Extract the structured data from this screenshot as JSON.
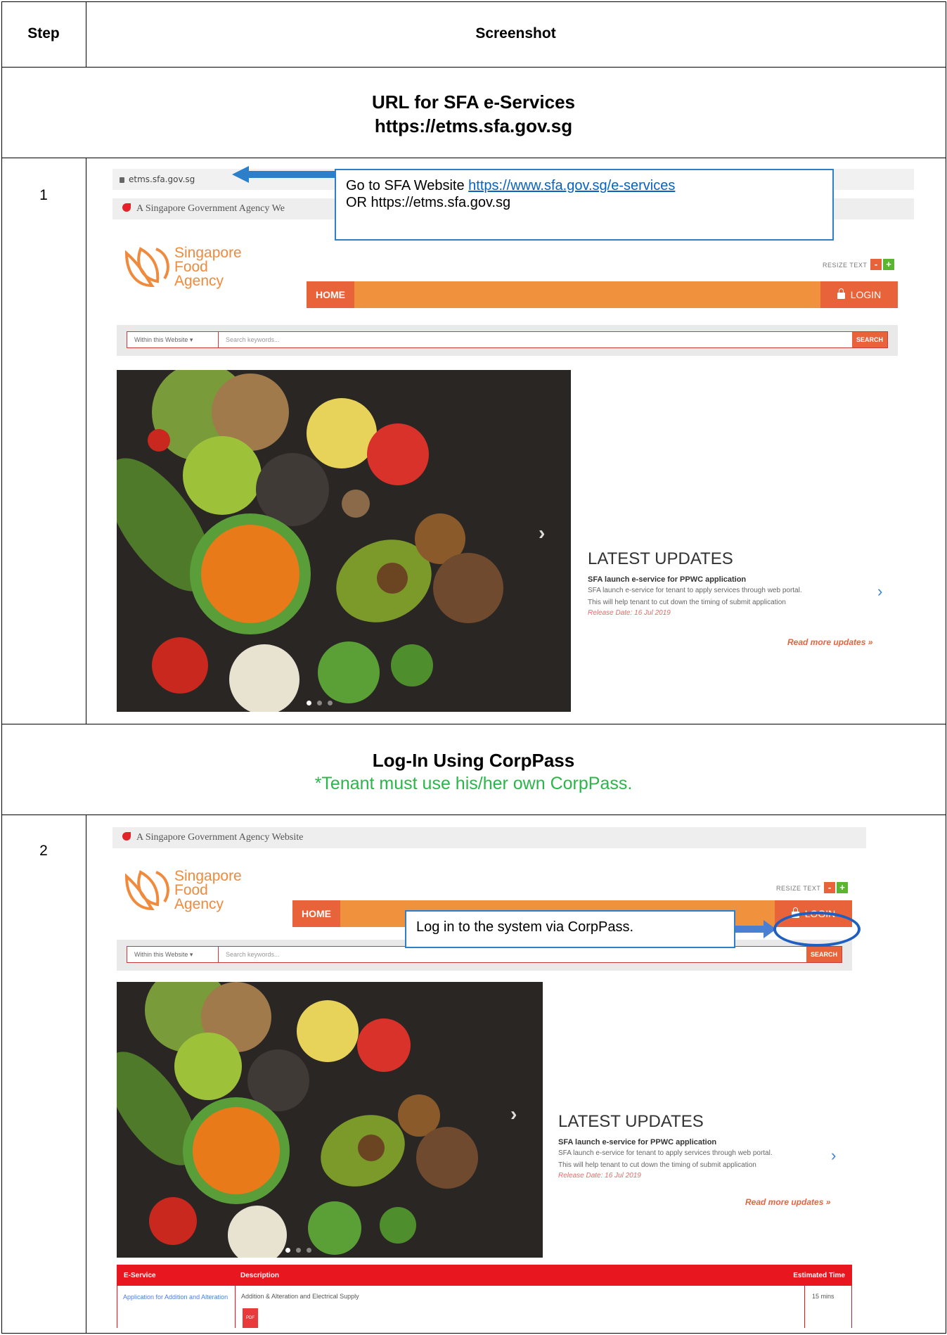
{
  "table": {
    "step_header": "Step",
    "screenshot_header": "Screenshot"
  },
  "sections": [
    {
      "title": "URL for SFA e-Services",
      "subtitle": "https://etms.sfa.gov.sg"
    },
    {
      "title": "Log-In Using CorpPass",
      "subtitle": "*Tenant must use his/her own CorpPass."
    }
  ],
  "steps": [
    {
      "number": "1",
      "address_bar": "etms.sfa.gov.sg",
      "callout_line1_prefix": "Go to SFA Website ",
      "callout_link": "https://www.sfa.gov.sg/e-services",
      "callout_line2": "OR https://etms.sfa.gov.sg"
    },
    {
      "number": "2",
      "callout": "Log in to the system via CorpPass."
    }
  ],
  "site": {
    "gov_banner": "A Singapore Government Agency Website",
    "gov_banner_cut": "A Singapore Government Agency We",
    "logo_line1": "Singapore",
    "logo_line2": "Food",
    "logo_line3": "Agency",
    "resize_text": "RESIZE TEXT",
    "resize_minus": "-",
    "resize_plus": "+",
    "nav_home": "HOME",
    "nav_login": "LOGIN",
    "search_scope": "Within this Website",
    "search_placeholder": "Search keywords...",
    "search_button": "SEARCH",
    "updates_title": "LATEST UPDATES",
    "update_headline": "SFA launch e-service for PPWC application",
    "update_line1": "SFA launch e-service for tenant to apply services through web portal.",
    "update_line2": "This will help tenant to cut down the timing of submit application",
    "update_date": "Release Date: 16 Jul 2019",
    "read_more": "Read more updates »",
    "eservice_table": {
      "headers": [
        "E-Service",
        "Description",
        "Estimated Time"
      ],
      "row": {
        "service": "Application for Addition and Alteration",
        "description": "Addition & Alteration and Electrical Supply",
        "time": "15 mins",
        "pdf": "PDF"
      }
    }
  },
  "colors": {
    "accent_orange": "#f0923d",
    "login_orange": "#e8633a",
    "callout_blue": "#2d7fc9",
    "subtitle_green": "#2bb54a",
    "table_red": "#e8171f"
  },
  "icons": {
    "gov_banner": "lion-head-icon",
    "address": "lock-icon",
    "login": "padlock-icon",
    "slider_next": "chevron-right-icon",
    "updates_next": "chevron-right-icon",
    "pdf": "pdf-icon"
  }
}
